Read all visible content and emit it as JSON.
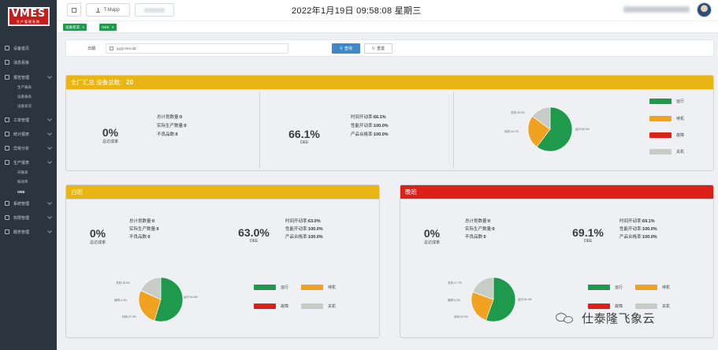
{
  "app": {
    "logo_text": "VMES",
    "logo_subtext": "生产管理系统"
  },
  "sidebar": {
    "items": [
      {
        "label": "设备首页"
      },
      {
        "label": "消息看板"
      },
      {
        "label": "报告管理",
        "expanded": true,
        "children": [
          "生产报表",
          "设备报表",
          "设备状况"
        ]
      },
      {
        "label": "工单管理"
      },
      {
        "label": "统计报表"
      },
      {
        "label": "异常分析"
      },
      {
        "label": "生产报表",
        "expanded": true,
        "children": [
          "日报表",
          "稼动率",
          "OEE"
        ],
        "active_child": "OEE"
      },
      {
        "label": "系统管理"
      },
      {
        "label": "权限管理"
      },
      {
        "label": "服务管理"
      }
    ]
  },
  "header": {
    "app_button_label": "T-Mapp",
    "datetime": "2022年1月19日 09:58:08 星期三"
  },
  "tags": [
    {
      "label": "设备状况"
    },
    {
      "label": "OEE"
    }
  ],
  "query": {
    "date_label": "日期",
    "date_value": "yyyy-mm-dd",
    "search_label": "查询",
    "reset_label": "重置"
  },
  "summary": {
    "title": "全厂汇总 设备总数:",
    "device_count": "20",
    "completion_rate": "0%",
    "completion_label": "总达成率",
    "plan_items": [
      {
        "label": "总计划数量:",
        "value": "0"
      },
      {
        "label": "实际生产数量:",
        "value": "0"
      },
      {
        "label": "不良品数:",
        "value": "0"
      }
    ],
    "oee_value": "66.1%",
    "oee_label": "OEE",
    "rate_items": [
      {
        "label": "时间开动率:",
        "value": "66.1%"
      },
      {
        "label": "性能开动率:",
        "value": "100.0%"
      },
      {
        "label": "产品合格率:",
        "value": "100.0%"
      }
    ],
    "pie_labels": [
      "关机:15.0%",
      "待机:24.7%",
      "运行:60.3%"
    ],
    "legend": [
      {
        "label": "运行",
        "color": "#1f9a4d"
      },
      {
        "label": "待机",
        "color": "#f2a221"
      },
      {
        "label": "故障",
        "color": "#dc2119"
      },
      {
        "label": "关机",
        "color": "#c7ccc6"
      }
    ]
  },
  "day_shift": {
    "title": "白班",
    "completion_rate": "0%",
    "completion_label": "总达成率",
    "plan_items": [
      {
        "label": "总计划数量:",
        "value": "0"
      },
      {
        "label": "实际生产数量:",
        "value": "0"
      },
      {
        "label": "不良品数:",
        "value": "0"
      }
    ],
    "oee_value": "63.0%",
    "oee_label": "OEE",
    "rate_items": [
      {
        "label": "时间开动率:",
        "value": "63.0%"
      },
      {
        "label": "性能开动率:",
        "value": "100.0%"
      },
      {
        "label": "产品合格率:",
        "value": "100.0%"
      }
    ],
    "pie_labels": [
      "关机:18.0%",
      "故障:0.3%",
      "待机:27.0%",
      "运行:54.6%"
    ],
    "legend": [
      {
        "label": "运行",
        "color": "#1f9a4d"
      },
      {
        "label": "待机",
        "color": "#f2a221"
      },
      {
        "label": "故障",
        "color": "#dc2119"
      },
      {
        "label": "关机",
        "color": "#c7ccc6"
      }
    ]
  },
  "night_shift": {
    "title": "晚班",
    "completion_rate": "0%",
    "completion_label": "总达成率",
    "plan_items": [
      {
        "label": "总计划数量:",
        "value": "0"
      },
      {
        "label": "实际生产数量:",
        "value": "0"
      },
      {
        "label": "不良品数:",
        "value": "0"
      }
    ],
    "oee_value": "69.1%",
    "oee_label": "OEE",
    "rate_items": [
      {
        "label": "时间开动率:",
        "value": "69.1%"
      },
      {
        "label": "性能开动率:",
        "value": "100.0%"
      },
      {
        "label": "产品合格率:",
        "value": "100.0%"
      }
    ],
    "pie_labels": [
      "关机:17.7%",
      "故障:0.2%",
      "待机:23.0%",
      "运行:51.0%"
    ],
    "legend": [
      {
        "label": "运行",
        "color": "#1f9a4d"
      },
      {
        "label": "待机",
        "color": "#f2a221"
      },
      {
        "label": "故障",
        "color": "#dc2119"
      },
      {
        "label": "关机",
        "color": "#c7ccc6"
      }
    ]
  },
  "chart_data": [
    {
      "type": "pie",
      "categories": [
        "运行",
        "待机",
        "故障",
        "关机"
      ],
      "values": [
        60.3,
        24.7,
        0,
        15.0
      ],
      "colors": [
        "#1f9a4d",
        "#f2a221",
        "#dc2119",
        "#c7ccc6"
      ]
    },
    {
      "type": "pie",
      "categories": [
        "运行",
        "待机",
        "故障",
        "关机"
      ],
      "values": [
        54.6,
        27.0,
        0.3,
        18.0
      ],
      "colors": [
        "#1f9a4d",
        "#f2a221",
        "#dc2119",
        "#c7ccc6"
      ]
    },
    {
      "type": "pie",
      "categories": [
        "运行",
        "待机",
        "故障",
        "关机"
      ],
      "values": [
        51.0,
        23.0,
        0.2,
        17.7
      ],
      "colors": [
        "#1f9a4d",
        "#f2a221",
        "#dc2119",
        "#c7ccc6"
      ]
    }
  ],
  "watermark": {
    "text": "仕泰隆飞象云"
  }
}
